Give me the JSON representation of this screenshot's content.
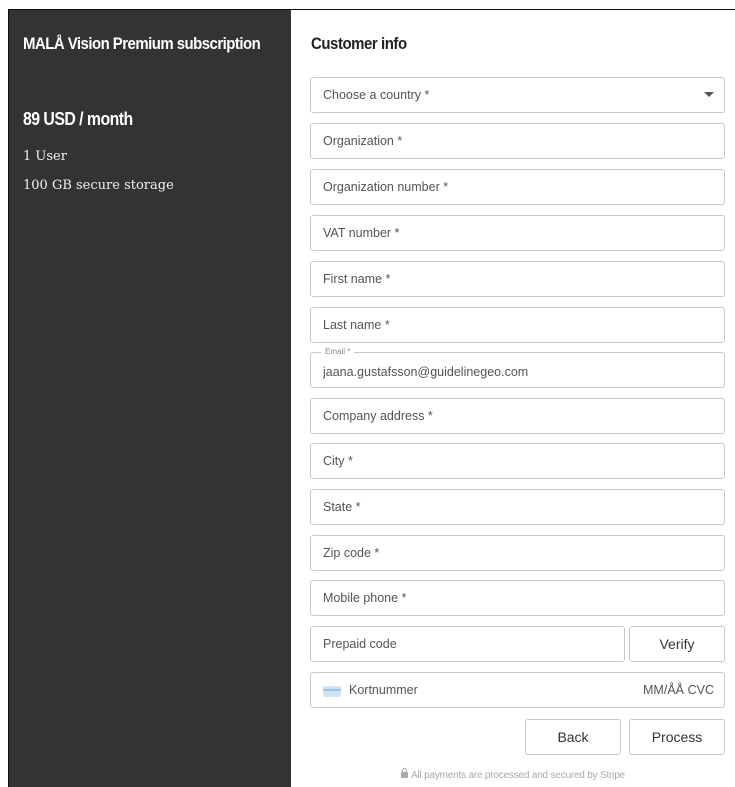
{
  "sidebar": {
    "title": "MALÅ Vision Premium subscription",
    "price": "89 USD / month",
    "features": [
      "1 User",
      "100 GB secure storage"
    ]
  },
  "form": {
    "title": "Customer info",
    "country_placeholder": "Choose a country *",
    "organization_placeholder": "Organization *",
    "organization_number_placeholder": "Organization number *",
    "vat_placeholder": "VAT number *",
    "first_name_placeholder": "First name *",
    "last_name_placeholder": "Last name *",
    "email_label": "Email *",
    "email_value": "jaana.gustafsson@guidelinegeo.com",
    "address_placeholder": "Company address *",
    "city_placeholder": "City *",
    "state_placeholder": "State *",
    "zip_placeholder": "Zip code *",
    "mobile_placeholder": "Mobile phone *",
    "prepaid_placeholder": "Prepaid code",
    "verify_label": "Verify",
    "card_number_placeholder": "Kortnummer",
    "card_expiry_placeholder": "MM/ÅÅ",
    "card_cvc_placeholder": "CVC",
    "back_label": "Back",
    "process_label": "Process",
    "footer_note": "All payments are processed and secured by Stripe"
  },
  "icons": {
    "country_dropdown": "chevron-down-icon",
    "card": "credit-card-icon",
    "lock": "lock-icon"
  },
  "colors": {
    "sidebar_bg": "#333333",
    "sidebar_text": "#ffffff",
    "border": "#c8c8c8",
    "footer_text": "#aaaaaa"
  }
}
